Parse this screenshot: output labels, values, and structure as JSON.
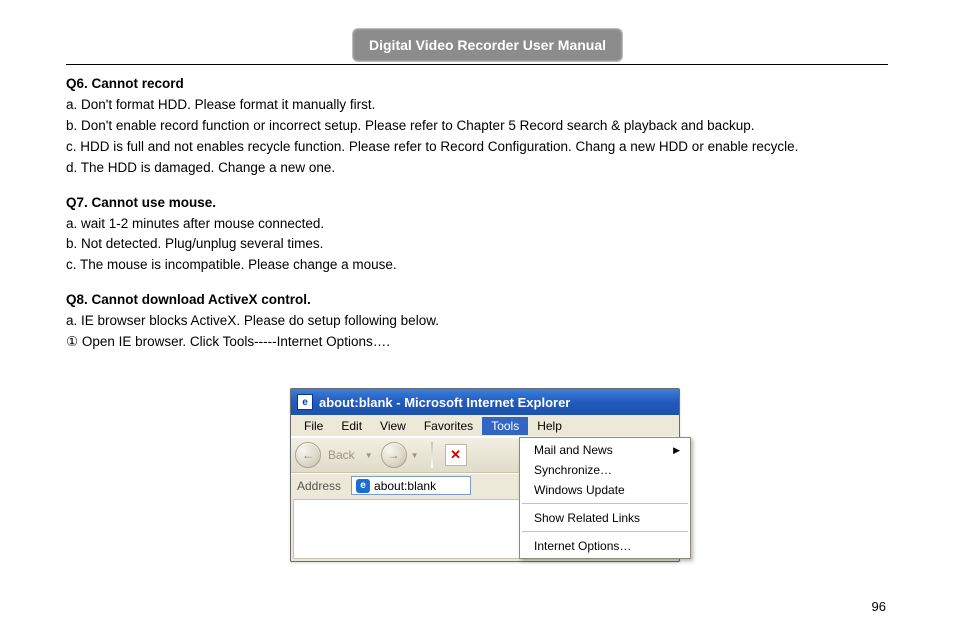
{
  "header": {
    "title": "Digital Video Recorder User Manual"
  },
  "page_number": "96",
  "q6": {
    "title": "Q6. Cannot record",
    "a": "a. Don't format HDD. Please format it manually first.",
    "b": "b. Don't enable record function or incorrect setup. Please refer to Chapter 5 Record search & playback and backup.",
    "c": "c. HDD is full and not enables recycle function. Please refer to Record Configuration. Chang a new HDD or enable recycle.",
    "d": "d. The HDD is damaged. Change a new one."
  },
  "q7": {
    "title": "Q7. Cannot use mouse.",
    "a": "a. wait 1-2 minutes after mouse connected.",
    "b": "b. Not detected. Plug/unplug several times.",
    "c": "c. The mouse is incompatible. Please change a mouse."
  },
  "q8": {
    "title": "Q8. Cannot download ActiveX control.",
    "a": "a. IE browser blocks ActiveX. Please do setup following below.",
    "step1": "① Open IE browser. Click Tools-----Internet Options…."
  },
  "ie": {
    "title": "about:blank - Microsoft Internet Explorer",
    "menu": {
      "file": "File",
      "edit": "Edit",
      "view": "View",
      "favorites": "Favorites",
      "tools": "Tools",
      "help": "Help"
    },
    "toolbar": {
      "back": "Back"
    },
    "address": {
      "label": "Address",
      "value": "about:blank"
    },
    "dropdown": {
      "mail": "Mail and News",
      "sync": "Synchronize…",
      "update": "Windows Update",
      "links": "Show Related Links",
      "options": "Internet Options…"
    }
  }
}
